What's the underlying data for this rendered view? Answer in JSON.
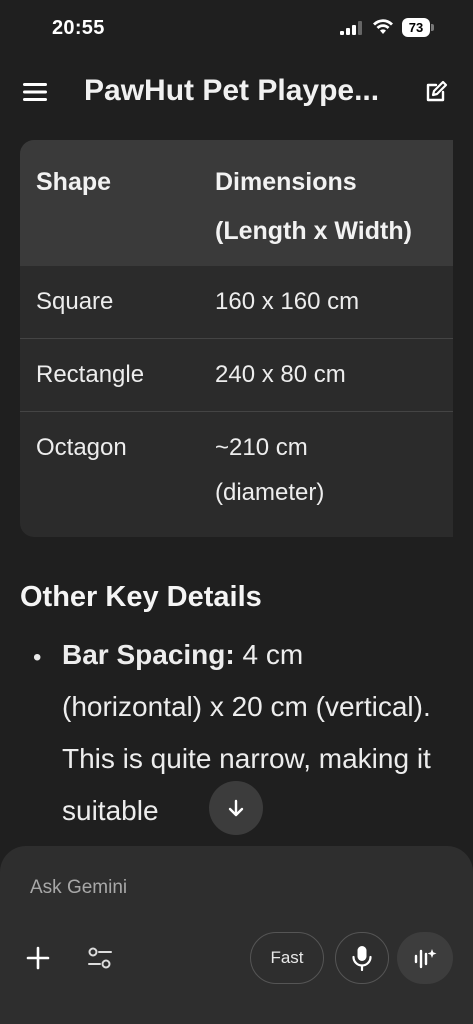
{
  "status_bar": {
    "time": "20:55",
    "battery": "73"
  },
  "header": {
    "title": "PawHut Pet Plaype..."
  },
  "table": {
    "headers": [
      "Shape",
      "Dimensions",
      "(Length x Width)"
    ],
    "rows": [
      {
        "shape": "Square",
        "dimension_line1": "160 x 160 cm",
        "dimension_line2": ""
      },
      {
        "shape": "Rectangle",
        "dimension_line1": "240 x 80 cm",
        "dimension_line2": ""
      },
      {
        "shape": "Octagon",
        "dimension_line1": "~210 cm",
        "dimension_line2": "(diameter)"
      }
    ]
  },
  "section": {
    "title": "Other Key Details",
    "bullet_label": "Bar Spacing:",
    "bullet_text": " 4 cm (horizontal) x 20 cm (vertical). This is quite narrow, making it suitable"
  },
  "composer": {
    "placeholder": "Ask Gemini",
    "mode_label": "Fast"
  },
  "icons": [
    "signal-icon",
    "wifi-icon",
    "battery-icon",
    "menu-icon",
    "edit-icon",
    "arrow-down-icon",
    "plus-icon",
    "tune-icon",
    "mic-icon",
    "live-icon"
  ]
}
